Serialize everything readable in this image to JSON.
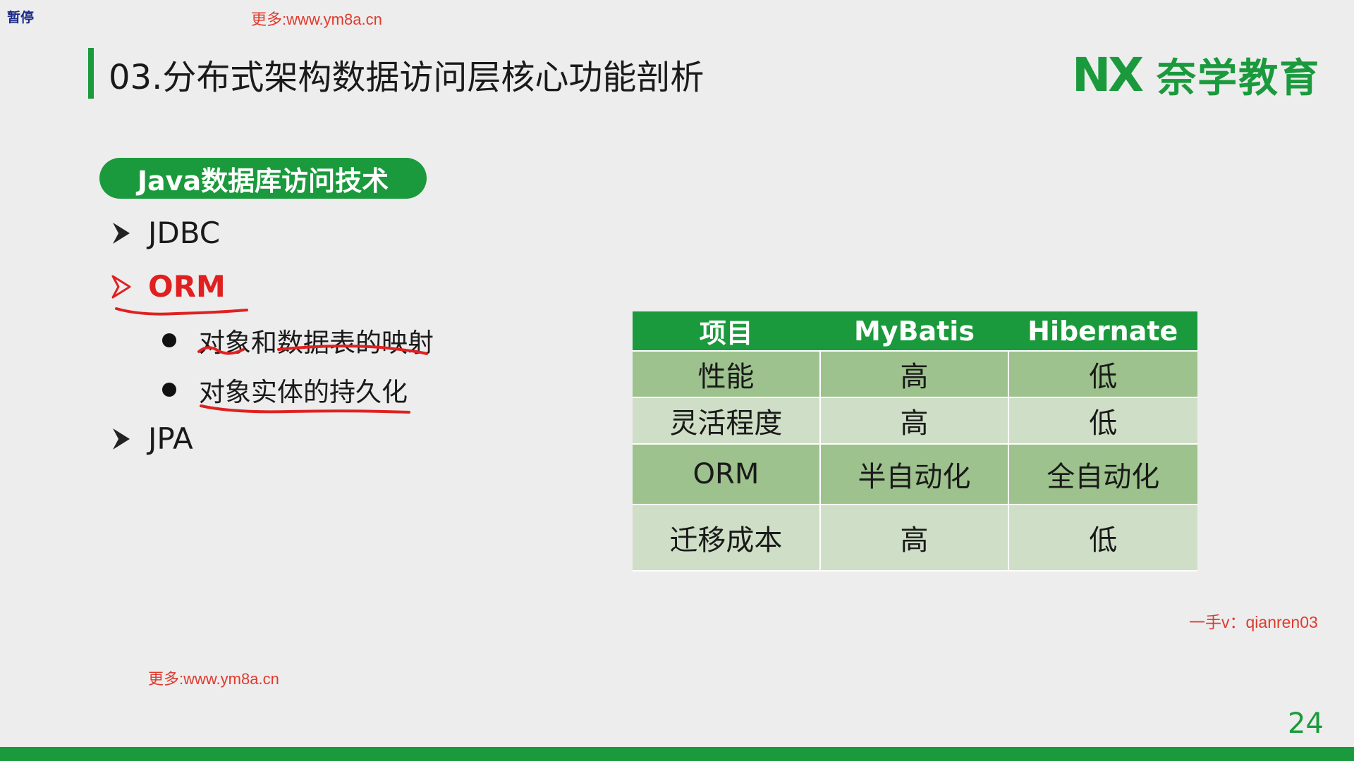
{
  "overlay": {
    "pause_label": "暂停"
  },
  "watermarks": {
    "top": "更多:www.ym8a.cn",
    "bottom": "更多:www.ym8a.cn"
  },
  "slide": {
    "title": "03.分布式架构数据访问层核心功能剖析",
    "logo": {
      "mark": "NX",
      "text": "奈学教育"
    },
    "section_pill": "Java数据库访问技术",
    "bullets": [
      {
        "label": "JDBC",
        "icon": "arrow-right-icon"
      },
      {
        "label": "ORM",
        "icon": "arrow-right-icon",
        "highlighted": true
      },
      {
        "label": "JPA",
        "icon": "arrow-right-icon"
      }
    ],
    "orm_points": [
      "对象和数据表的映射",
      "对象实体的持久化"
    ],
    "table": {
      "headers": [
        "项目",
        "MyBatis",
        "Hibernate"
      ],
      "rows": [
        [
          "性能",
          "高",
          "低"
        ],
        [
          "灵活程度",
          "高",
          "低"
        ],
        [
          "ORM",
          "半自动化",
          "全自动化"
        ],
        [
          "迁移成本",
          "高",
          "低"
        ]
      ]
    },
    "contact": "一手v：qianren03",
    "page_number": "24"
  },
  "colors": {
    "brand_green": "#1a9a3c",
    "highlight_red": "#e02020",
    "row_dark": "#9dc28d",
    "row_light": "#cfdec6"
  }
}
